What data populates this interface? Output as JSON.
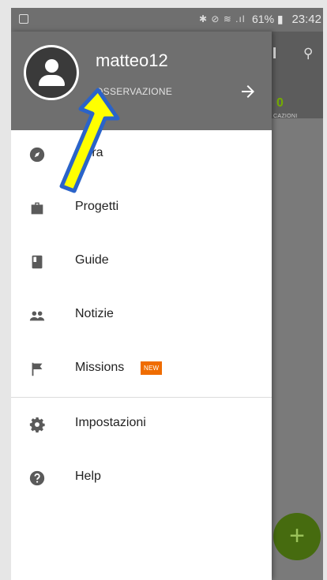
{
  "status_bar": {
    "status_icons": "✱ ⊘ ≋ .ıl",
    "battery": "61% ▮",
    "time": "23:42"
  },
  "background_app": {
    "count": "0",
    "count_label": "CAZIONI",
    "fab_label": "+"
  },
  "drawer": {
    "header": {
      "username": "matteo12",
      "label": "OSSERVAZIONE"
    },
    "items": [
      {
        "label": "plora",
        "icon": "compass-icon"
      },
      {
        "label": "Progetti",
        "icon": "briefcase-icon"
      },
      {
        "label": "Guide",
        "icon": "book-icon"
      },
      {
        "label": "Notizie",
        "icon": "people-icon"
      },
      {
        "label": "Missions",
        "icon": "flag-icon",
        "badge": "NEW"
      },
      {
        "label": "Impostazioni",
        "icon": "gear-icon"
      },
      {
        "label": "Help",
        "icon": "help-icon"
      }
    ]
  },
  "colors": {
    "header": "#6f6f6f",
    "icon": "#5a5a5a",
    "badge": "#ef6c00",
    "annotation_fill": "#ffff00",
    "annotation_stroke": "#2a63c9",
    "fab": "#466b0f"
  }
}
